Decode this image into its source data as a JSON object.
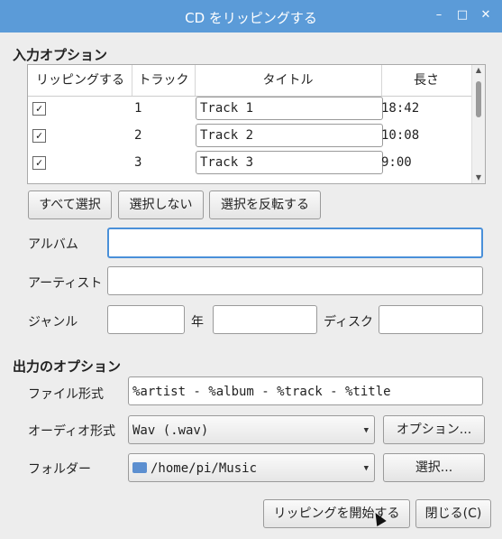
{
  "window": {
    "title": "CD をリッピングする",
    "minimize_icon": "minimize-icon",
    "maximize_icon": "maximize-icon",
    "close_icon": "close-icon"
  },
  "input_section": {
    "heading": "入力オプション",
    "columns": [
      "リッピングする",
      "トラック",
      "タイトル",
      "長さ"
    ],
    "tracks": [
      {
        "rip": true,
        "track": "1",
        "title": "Track 1",
        "length": "18:42"
      },
      {
        "rip": true,
        "track": "2",
        "title": "Track 2",
        "length": "10:08"
      },
      {
        "rip": true,
        "track": "3",
        "title": "Track 3",
        "length": "9:00"
      }
    ],
    "select_all": "すべて選択",
    "select_none": "選択しない",
    "invert_selection": "選択を反転する",
    "album_label": "アルバム",
    "album_value": "",
    "artist_label": "アーティスト",
    "artist_value": "",
    "genre_label": "ジャンル",
    "genre_value": "",
    "year_label": "年",
    "year_value": "",
    "disc_label": "ディスク",
    "disc_value": ""
  },
  "output_section": {
    "heading": "出力のオプション",
    "file_format_label": "ファイル形式",
    "file_format_value": "%artist - %album - %track - %title",
    "audio_format_label": "オーディオ形式",
    "audio_format_value": "Wav (.wav)",
    "options_button": "オプション...",
    "folder_label": "フォルダー",
    "folder_value": "/home/pi/Music",
    "folder_select_button": "選択..."
  },
  "footer": {
    "start_button": "リッピングを開始する",
    "close_button": "閉じる(C)"
  }
}
